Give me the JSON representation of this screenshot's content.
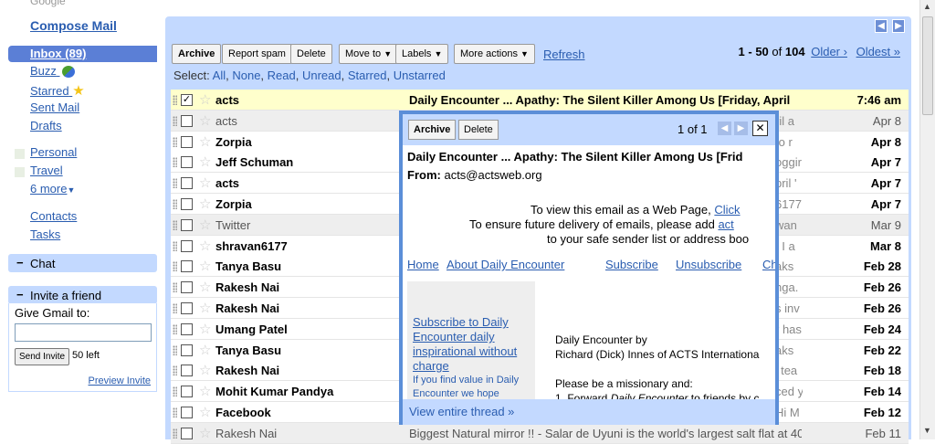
{
  "nav": {
    "compose": "Compose Mail",
    "inbox": "Inbox (89)",
    "links": [
      {
        "label": "Buzz",
        "key": "buzz"
      },
      {
        "label": "Starred",
        "key": "starred"
      },
      {
        "label": "Sent Mail",
        "key": "sent"
      },
      {
        "label": "Drafts",
        "key": "drafts"
      }
    ],
    "labels": [
      {
        "label": "Personal"
      },
      {
        "label": "Travel"
      }
    ],
    "more": "6 more",
    "contacts": "Contacts",
    "tasks": "Tasks",
    "chat": "Chat",
    "invite_title": "Invite a friend",
    "invite_label": "Give Gmail to:",
    "send_invite": "Send Invite",
    "left_count": "50 left",
    "preview_invite": "Preview Invite"
  },
  "toolbar": {
    "archive": "Archive",
    "report_spam": "Report spam",
    "delete": "Delete",
    "move_to": "Move to",
    "labels": "Labels",
    "more_actions": "More actions",
    "refresh": "Refresh",
    "range": "1 - 50",
    "of": "of",
    "total": "104",
    "older": "Older ›",
    "oldest": "Oldest »",
    "select_prefix": "Select:",
    "select_options": [
      "All",
      "None",
      "Read",
      "Unread",
      "Starred",
      "Unstarred"
    ]
  },
  "emails": [
    {
      "from": "acts",
      "subject": "Daily Encounter ... Apathy: The Silent Killer Among Us [Friday, April",
      "snippet": "",
      "date": "7:46 am",
      "state": "selected",
      "checked": "✓"
    },
    {
      "from": "acts",
      "subject": "",
      "snippet": "ril a",
      "date": "Apr 8",
      "state": "read",
      "checked": ""
    },
    {
      "from": "Zorpia",
      "subject": "",
      "snippet": "to r",
      "date": "Apr 8",
      "state": "unread",
      "checked": ""
    },
    {
      "from": "Jeff Schuman",
      "subject": "",
      "snippet": "oggir",
      "date": "Apr 7",
      "state": "unread",
      "checked": ""
    },
    {
      "from": "acts",
      "subject": "",
      "snippet": "pril '",
      "date": "Apr 7",
      "state": "unread",
      "checked": ""
    },
    {
      "from": "Zorpia",
      "subject": "",
      "snippet": "6177",
      "date": "Apr 7",
      "state": "unread",
      "checked": ""
    },
    {
      "from": "Twitter",
      "subject": "",
      "snippet": "wan",
      "date": "Mar 9",
      "state": "read",
      "checked": ""
    },
    {
      "from": "shravan6177",
      "subject": "",
      "snippet": ", I a",
      "date": "Mar 8",
      "state": "unread",
      "checked": ""
    },
    {
      "from": "Tanya Basu",
      "subject": "",
      "snippet": "aks",
      "date": "Feb 28",
      "state": "unread",
      "checked": ""
    },
    {
      "from": "Rakesh Nai",
      "subject": "",
      "snippet": "nga.",
      "date": "Feb 26",
      "state": "unread",
      "checked": ""
    },
    {
      "from": "Rakesh Nai",
      "subject": "",
      "snippet": "s inv",
      "date": "Feb 26",
      "state": "unread",
      "checked": ""
    },
    {
      "from": "Umang Patel",
      "subject": "",
      "snippet": "r has",
      "date": "Feb 24",
      "state": "unread",
      "checked": ""
    },
    {
      "from": "Tanya Basu",
      "subject": "",
      "snippet": "aks",
      "date": "Feb 22",
      "state": "unread",
      "checked": ""
    },
    {
      "from": "Rakesh Nai",
      "subject": "",
      "snippet": "' tea",
      "date": "Feb 18",
      "state": "unread",
      "checked": ""
    },
    {
      "from": "Mohit Kumar Pandya",
      "subject": "",
      "snippet": "ced y",
      "date": "Feb 14",
      "state": "unread",
      "checked": ""
    },
    {
      "from": "Facebook",
      "subject": "",
      "snippet": "Hi M",
      "date": "Feb 12",
      "state": "unread",
      "checked": ""
    },
    {
      "from": "Rakesh Nai",
      "subject": "Biggest Natural mirror !! - Salar de Uyuni is the world's largest salt flat at 40",
      "snippet": "",
      "date": "Feb 11",
      "state": "read",
      "checked": ""
    }
  ],
  "popup": {
    "archive": "Archive",
    "delete": "Delete",
    "count": "1 of 1",
    "close": "✕",
    "subject": "Daily Encounter ... Apathy: The Silent Killer Among Us [Frid",
    "from_label": "From:",
    "from_addr": "acts@actsweb.org",
    "line1": "To view this email as a Web Page,",
    "line1_link": "Click",
    "line2": "To ensure future delivery of emails, please add",
    "line2_link": "act",
    "line3": "to your safe sender list or address boo",
    "links": [
      "Home",
      "About Daily Encounter",
      "Subscribe",
      "Unsubscribe",
      "Ch"
    ],
    "subscribe_link": "Subscribe to Daily Encounter daily inspirational without charge",
    "small_note": "If you find value in Daily Encounter we hope",
    "body1": "Daily Encounter by",
    "body2": "Richard (Dick) Innes of ACTS Internationa",
    "body3": "Please be a missionary and:",
    "body4a": "1. Forward ",
    "body4b": "Daily Encounter",
    "body4c": " to friends by c",
    "view_thread": "View entire thread »"
  }
}
